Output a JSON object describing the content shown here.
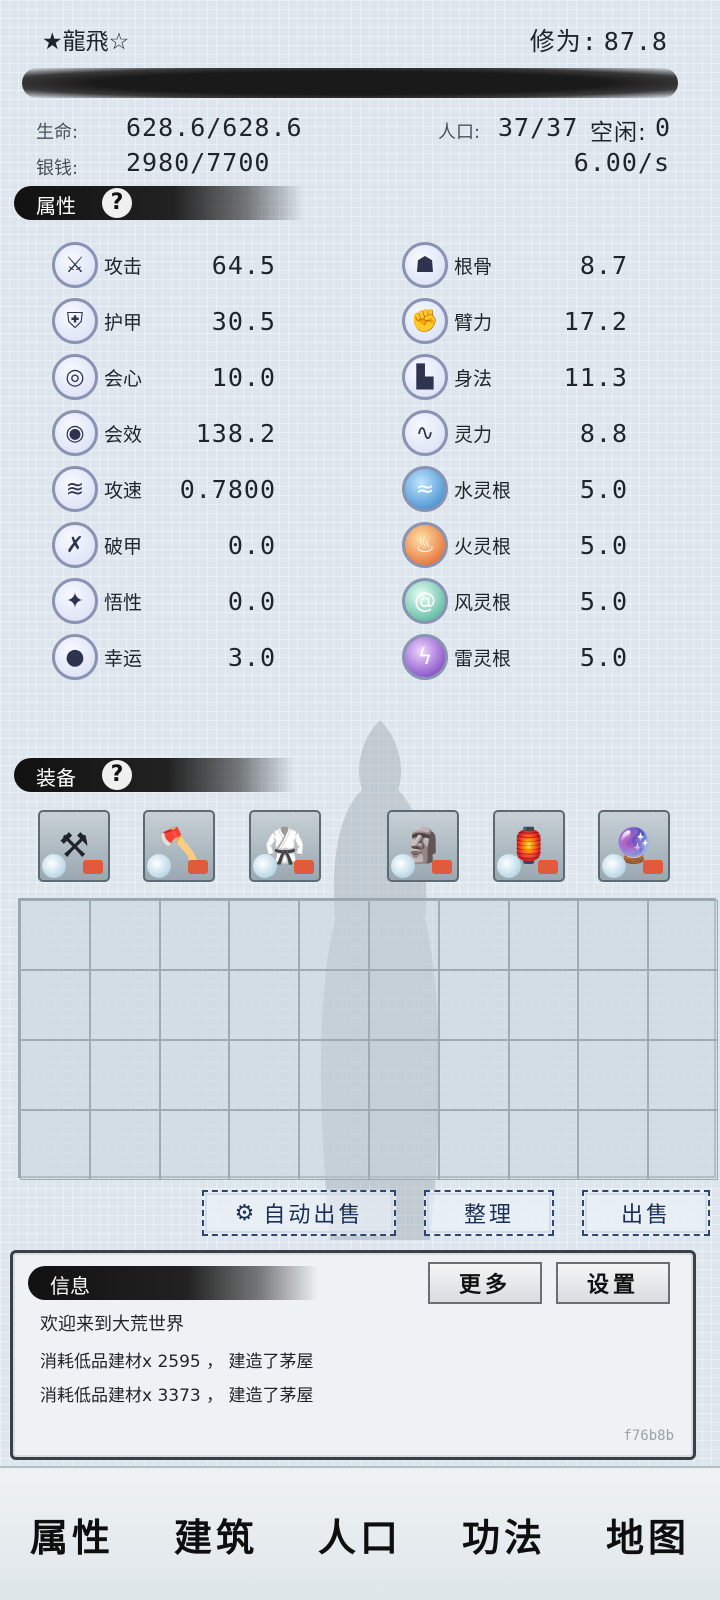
{
  "header": {
    "player_name": "★龍飛☆",
    "cultivation_label": "修为:",
    "cultivation_value": "87.8"
  },
  "stats": {
    "hp_label": "生命:",
    "hp_value": "628.6/628.6",
    "silver_label": "银钱:",
    "silver_value": "2980/7700",
    "pop_label": "人口:",
    "pop_value": "37/37",
    "idle_label": "空闲:",
    "idle_value": "0",
    "rate_value": "6.00/s"
  },
  "sections": {
    "attributes_title": "属性",
    "equipment_title": "装备",
    "info_title": "信息"
  },
  "attributes_left": [
    {
      "name": "攻击",
      "value": "64.5",
      "icon": "sword-icon"
    },
    {
      "name": "护甲",
      "value": "30.5",
      "icon": "shield-icon"
    },
    {
      "name": "会心",
      "value": "10.0",
      "icon": "target-icon"
    },
    {
      "name": "会效",
      "value": "138.2",
      "icon": "bullseye-icon"
    },
    {
      "name": "攻速",
      "value": "0.7800",
      "icon": "speed-icon"
    },
    {
      "name": "破甲",
      "value": "0.0",
      "icon": "broken-shield-icon"
    },
    {
      "name": "悟性",
      "value": "0.0",
      "icon": "star-icon"
    },
    {
      "name": "幸运",
      "value": "3.0",
      "icon": "luck-icon"
    }
  ],
  "attributes_right": [
    {
      "name": "根骨",
      "value": "8.7",
      "icon": "torso-icon"
    },
    {
      "name": "臂力",
      "value": "17.2",
      "icon": "arm-icon"
    },
    {
      "name": "身法",
      "value": "11.3",
      "icon": "boot-icon"
    },
    {
      "name": "灵力",
      "value": "8.8",
      "icon": "spirit-icon"
    },
    {
      "name": "水灵根",
      "value": "5.0",
      "icon": "water-icon"
    },
    {
      "name": "火灵根",
      "value": "5.0",
      "icon": "fire-icon"
    },
    {
      "name": "风灵根",
      "value": "5.0",
      "icon": "wind-icon"
    },
    {
      "name": "雷灵根",
      "value": "5.0",
      "icon": "thunder-icon"
    }
  ],
  "equipment": [
    {
      "slot": "weapon-staff",
      "glyph": "⚒"
    },
    {
      "slot": "weapon-axe",
      "glyph": "🪓"
    },
    {
      "slot": "armor",
      "glyph": "🥋"
    },
    {
      "slot": "seal",
      "glyph": "🗿"
    },
    {
      "slot": "talisman",
      "glyph": "🏮"
    },
    {
      "slot": "pendant",
      "glyph": "🔮"
    }
  ],
  "buttons": {
    "auto_sell": "自动出售",
    "organize": "整理",
    "sell": "出售",
    "more": "更多",
    "settings": "设置"
  },
  "log": [
    "欢迎来到大荒世界",
    "消耗低品建材x 2595 ， 建造了茅屋",
    "消耗低品建材x 3373 ， 建造了茅屋"
  ],
  "version": "f76b8b",
  "nav": [
    "属性",
    "建筑",
    "人口",
    "功法",
    "地图"
  ]
}
